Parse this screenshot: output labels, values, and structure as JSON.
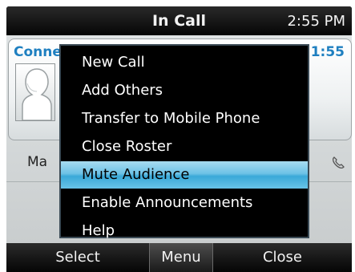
{
  "status_bar": {
    "title": "In Call",
    "time": "2:55 PM"
  },
  "call": {
    "state": "Conne",
    "timer": "1:55",
    "participant_name": "Ma"
  },
  "menu": {
    "items": [
      {
        "label": "New Call"
      },
      {
        "label": "Add Others"
      },
      {
        "label": "Transfer to Mobile Phone"
      },
      {
        "label": "Close Roster"
      },
      {
        "label": "Mute Audience",
        "selected": true
      },
      {
        "label": "Enable Announcements"
      },
      {
        "label": "Help"
      }
    ]
  },
  "softkeys": {
    "left": "Select",
    "center": "Menu",
    "right": "Close"
  },
  "colors": {
    "accent_blue": "#1e7fc0",
    "selection_highlight": "#6dc2e6"
  },
  "icons": {
    "avatar": "person-silhouette-icon",
    "phone": "phone-icon"
  }
}
